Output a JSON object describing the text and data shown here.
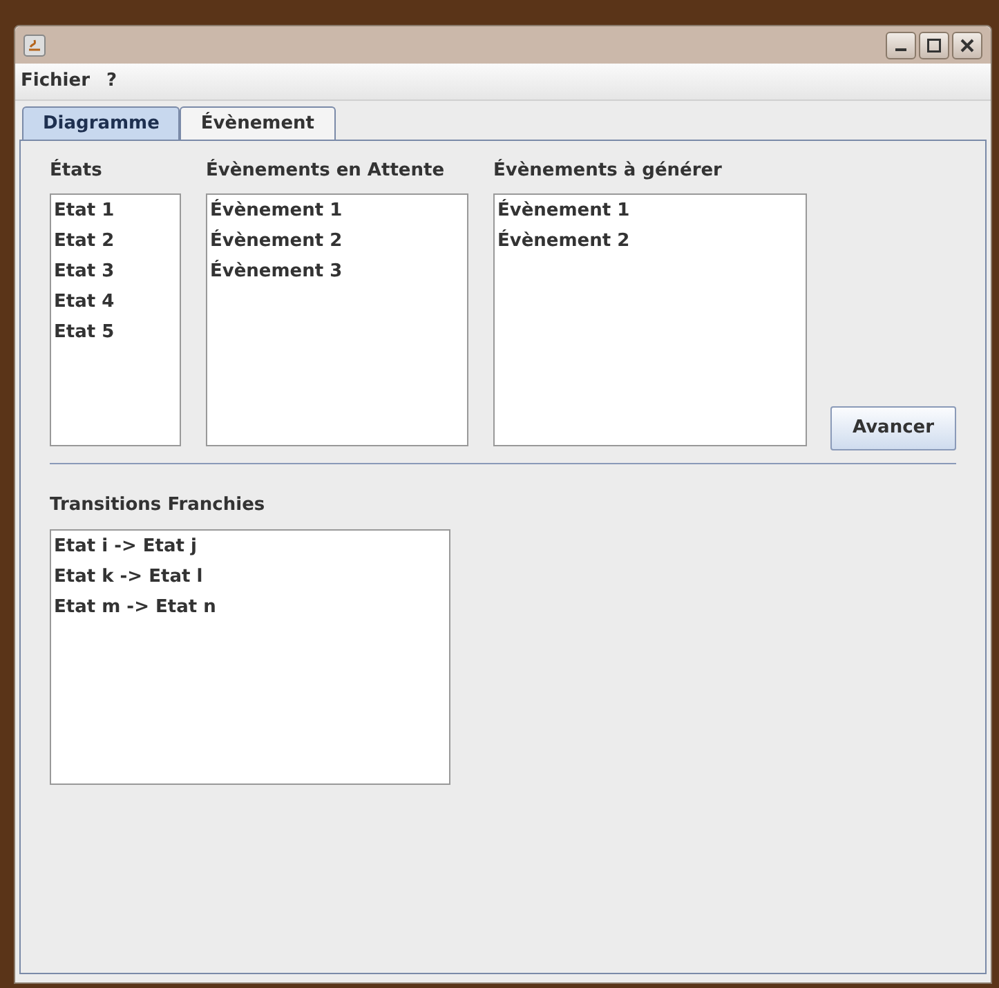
{
  "menu": [
    "Fichier",
    "?"
  ],
  "tabs": [
    {
      "label": "Diagramme",
      "selected": true
    },
    {
      "label": "Évènement",
      "selected": false
    }
  ],
  "lists": [
    {
      "title": "États",
      "items": [
        "Etat 1",
        "Etat 2",
        "Etat 3",
        "Etat 4",
        "Etat 5"
      ]
    },
    {
      "title": "Évènements en Attente",
      "items": [
        "Évènement 1",
        "Évènement 2",
        "Évènement 3"
      ]
    },
    {
      "title": "Évènements à générer",
      "items": [
        "Évènement 1",
        "Évènement 2"
      ]
    }
  ],
  "button": "Avancer",
  "transitions": {
    "title": "Transitions Franchies",
    "items": [
      "Etat i -> Etat j",
      "Etat k -> Etat l",
      "Etat m -> Etat n"
    ]
  }
}
